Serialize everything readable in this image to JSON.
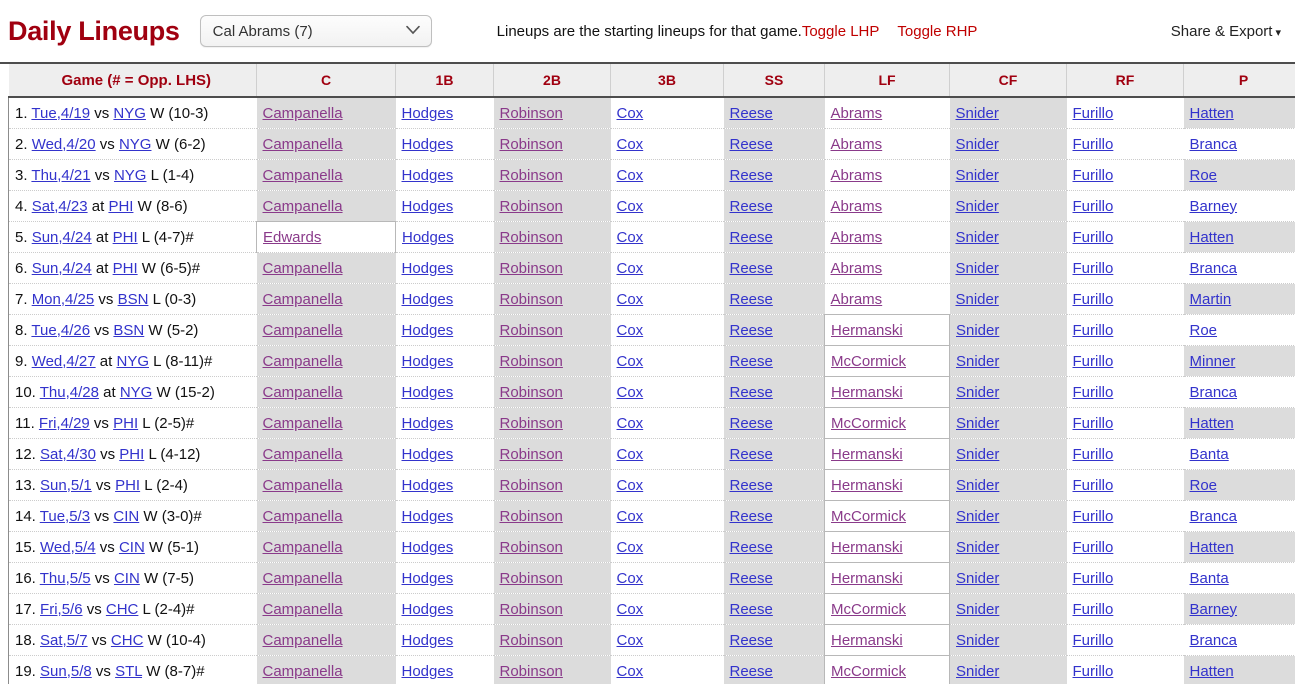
{
  "header": {
    "title": "Daily Lineups",
    "player_select": {
      "selected": "Cal Abrams (7)",
      "options": [
        "Cal Abrams (7)"
      ],
      "icon": "chevron-down-icon"
    },
    "note": "Lineups are the starting lineups for that game.",
    "toggle_lhp": "Toggle LHP",
    "toggle_rhp": "Toggle RHP",
    "share_export": "Share & Export",
    "share_caret": "▾"
  },
  "colors": {
    "brand_red": "#a00010",
    "link_red": "#c00000",
    "link_blue": "#3333cc",
    "link_visited": "#8a3a8a",
    "shaded_cell": "#dcdcdc",
    "header_bg": "#eeeeee"
  },
  "table": {
    "columns": [
      "Game (# = Opp. LHS)",
      "C",
      "1B",
      "2B",
      "3B",
      "SS",
      "LF",
      "CF",
      "RF",
      "P"
    ],
    "rows": [
      {
        "idx": "1.",
        "day": "Tue,4/19",
        "loc": "vs",
        "opp": "NYG",
        "result": "W (10-3)",
        "c": "Campanella",
        "b1": "Hodges",
        "b2": "Robinson",
        "b3": "Cox",
        "ss": "Reese",
        "lf": "Abrams",
        "cf": "Snider",
        "rf": "Furillo",
        "p": "Hatten"
      },
      {
        "idx": "2.",
        "day": "Wed,4/20",
        "loc": "vs",
        "opp": "NYG",
        "result": "W (6-2)",
        "c": "Campanella",
        "b1": "Hodges",
        "b2": "Robinson",
        "b3": "Cox",
        "ss": "Reese",
        "lf": "Abrams",
        "cf": "Snider",
        "rf": "Furillo",
        "p": "Branca"
      },
      {
        "idx": "3.",
        "day": "Thu,4/21",
        "loc": "vs",
        "opp": "NYG",
        "result": "L (1-4)",
        "c": "Campanella",
        "b1": "Hodges",
        "b2": "Robinson",
        "b3": "Cox",
        "ss": "Reese",
        "lf": "Abrams",
        "cf": "Snider",
        "rf": "Furillo",
        "p": "Roe"
      },
      {
        "idx": "4.",
        "day": "Sat,4/23",
        "loc": "at",
        "opp": "PHI",
        "result": "W (8-6)",
        "c": "Campanella",
        "b1": "Hodges",
        "b2": "Robinson",
        "b3": "Cox",
        "ss": "Reese",
        "lf": "Abrams",
        "cf": "Snider",
        "rf": "Furillo",
        "p": "Barney"
      },
      {
        "idx": "5.",
        "day": "Sun,4/24",
        "loc": "at",
        "opp": "PHI",
        "result": "L (4-7)#",
        "c": "Edwards",
        "b1": "Hodges",
        "b2": "Robinson",
        "b3": "Cox",
        "ss": "Reese",
        "lf": "Abrams",
        "cf": "Snider",
        "rf": "Furillo",
        "p": "Hatten"
      },
      {
        "idx": "6.",
        "day": "Sun,4/24",
        "loc": "at",
        "opp": "PHI",
        "result": "W (6-5)#",
        "c": "Campanella",
        "b1": "Hodges",
        "b2": "Robinson",
        "b3": "Cox",
        "ss": "Reese",
        "lf": "Abrams",
        "cf": "Snider",
        "rf": "Furillo",
        "p": "Branca"
      },
      {
        "idx": "7.",
        "day": "Mon,4/25",
        "loc": "vs",
        "opp": "BSN",
        "result": "L (0-3)",
        "c": "Campanella",
        "b1": "Hodges",
        "b2": "Robinson",
        "b3": "Cox",
        "ss": "Reese",
        "lf": "Abrams",
        "cf": "Snider",
        "rf": "Furillo",
        "p": "Martin"
      },
      {
        "idx": "8.",
        "day": "Tue,4/26",
        "loc": "vs",
        "opp": "BSN",
        "result": "W (5-2)",
        "c": "Campanella",
        "b1": "Hodges",
        "b2": "Robinson",
        "b3": "Cox",
        "ss": "Reese",
        "lf": "Hermanski",
        "cf": "Snider",
        "rf": "Furillo",
        "p": "Roe"
      },
      {
        "idx": "9.",
        "day": "Wed,4/27",
        "loc": "at",
        "opp": "NYG",
        "result": "L (8-11)#",
        "c": "Campanella",
        "b1": "Hodges",
        "b2": "Robinson",
        "b3": "Cox",
        "ss": "Reese",
        "lf": "McCormick",
        "cf": "Snider",
        "rf": "Furillo",
        "p": "Minner"
      },
      {
        "idx": "10.",
        "day": "Thu,4/28",
        "loc": "at",
        "opp": "NYG",
        "result": "W (15-2)",
        "c": "Campanella",
        "b1": "Hodges",
        "b2": "Robinson",
        "b3": "Cox",
        "ss": "Reese",
        "lf": "Hermanski",
        "cf": "Snider",
        "rf": "Furillo",
        "p": "Branca"
      },
      {
        "idx": "11.",
        "day": "Fri,4/29",
        "loc": "vs",
        "opp": "PHI",
        "result": "L (2-5)#",
        "c": "Campanella",
        "b1": "Hodges",
        "b2": "Robinson",
        "b3": "Cox",
        "ss": "Reese",
        "lf": "McCormick",
        "cf": "Snider",
        "rf": "Furillo",
        "p": "Hatten"
      },
      {
        "idx": "12.",
        "day": "Sat,4/30",
        "loc": "vs",
        "opp": "PHI",
        "result": "L (4-12)",
        "c": "Campanella",
        "b1": "Hodges",
        "b2": "Robinson",
        "b3": "Cox",
        "ss": "Reese",
        "lf": "Hermanski",
        "cf": "Snider",
        "rf": "Furillo",
        "p": "Banta"
      },
      {
        "idx": "13.",
        "day": "Sun,5/1",
        "loc": "vs",
        "opp": "PHI",
        "result": "L (2-4)",
        "c": "Campanella",
        "b1": "Hodges",
        "b2": "Robinson",
        "b3": "Cox",
        "ss": "Reese",
        "lf": "Hermanski",
        "cf": "Snider",
        "rf": "Furillo",
        "p": "Roe"
      },
      {
        "idx": "14.",
        "day": "Tue,5/3",
        "loc": "vs",
        "opp": "CIN",
        "result": "W (3-0)#",
        "c": "Campanella",
        "b1": "Hodges",
        "b2": "Robinson",
        "b3": "Cox",
        "ss": "Reese",
        "lf": "McCormick",
        "cf": "Snider",
        "rf": "Furillo",
        "p": "Branca"
      },
      {
        "idx": "15.",
        "day": "Wed,5/4",
        "loc": "vs",
        "opp": "CIN",
        "result": "W (5-1)",
        "c": "Campanella",
        "b1": "Hodges",
        "b2": "Robinson",
        "b3": "Cox",
        "ss": "Reese",
        "lf": "Hermanski",
        "cf": "Snider",
        "rf": "Furillo",
        "p": "Hatten"
      },
      {
        "idx": "16.",
        "day": "Thu,5/5",
        "loc": "vs",
        "opp": "CIN",
        "result": "W (7-5)",
        "c": "Campanella",
        "b1": "Hodges",
        "b2": "Robinson",
        "b3": "Cox",
        "ss": "Reese",
        "lf": "Hermanski",
        "cf": "Snider",
        "rf": "Furillo",
        "p": "Banta"
      },
      {
        "idx": "17.",
        "day": "Fri,5/6",
        "loc": "vs",
        "opp": "CHC",
        "result": "L (2-4)#",
        "c": "Campanella",
        "b1": "Hodges",
        "b2": "Robinson",
        "b3": "Cox",
        "ss": "Reese",
        "lf": "McCormick",
        "cf": "Snider",
        "rf": "Furillo",
        "p": "Barney"
      },
      {
        "idx": "18.",
        "day": "Sat,5/7",
        "loc": "vs",
        "opp": "CHC",
        "result": "W (10-4)",
        "c": "Campanella",
        "b1": "Hodges",
        "b2": "Robinson",
        "b3": "Cox",
        "ss": "Reese",
        "lf": "Hermanski",
        "cf": "Snider",
        "rf": "Furillo",
        "p": "Branca"
      },
      {
        "idx": "19.",
        "day": "Sun,5/8",
        "loc": "vs",
        "opp": "STL",
        "result": "W (8-7)#",
        "c": "Campanella",
        "b1": "Hodges",
        "b2": "Robinson",
        "b3": "Cox",
        "ss": "Reese",
        "lf": "McCormick",
        "cf": "Snider",
        "rf": "Furillo",
        "p": "Hatten"
      }
    ]
  }
}
